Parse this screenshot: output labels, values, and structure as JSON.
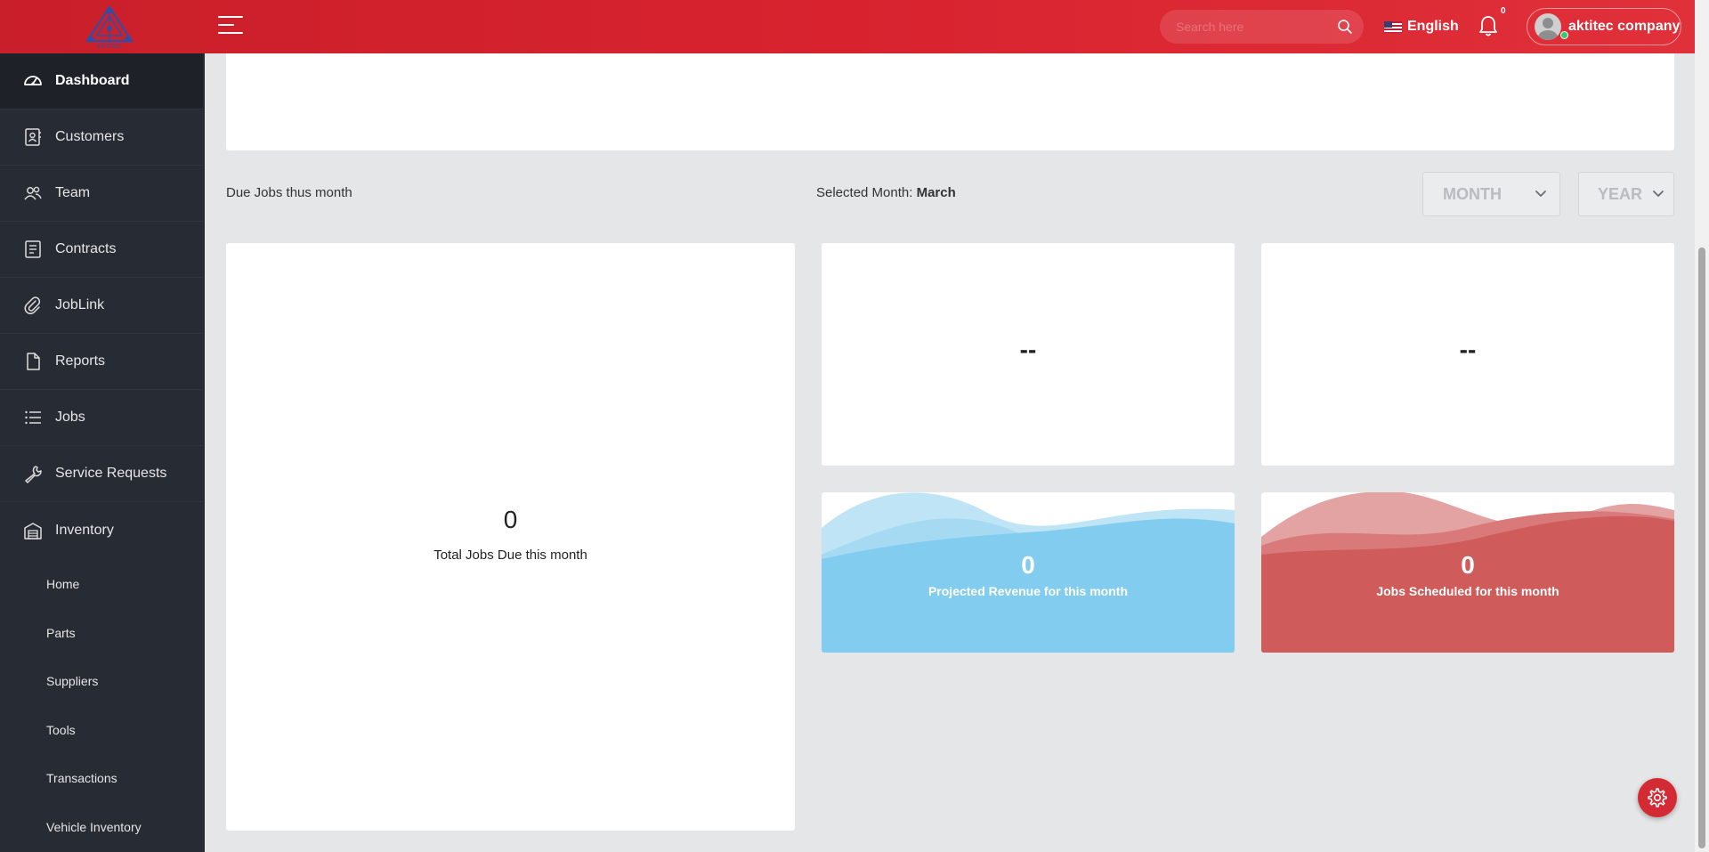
{
  "header": {
    "logo_text": "AKTITEC",
    "search_placeholder": "Search here",
    "language": "English",
    "notification_count": "0",
    "user_name": "aktitec company"
  },
  "sidebar": {
    "items": [
      {
        "label": "Dashboard",
        "icon": "speedometer-icon",
        "active": true
      },
      {
        "label": "Customers",
        "icon": "contact-book-icon"
      },
      {
        "label": "Team",
        "icon": "team-icon"
      },
      {
        "label": "Contracts",
        "icon": "contract-icon"
      },
      {
        "label": "JobLink",
        "icon": "paperclip-icon"
      },
      {
        "label": "Reports",
        "icon": "file-icon"
      },
      {
        "label": "Jobs",
        "icon": "list-icon"
      },
      {
        "label": "Service Requests",
        "icon": "wrench-icon"
      },
      {
        "label": "Inventory",
        "icon": "warehouse-icon"
      }
    ],
    "inventory_sub": [
      "Home",
      "Parts",
      "Suppliers",
      "Tools",
      "Transactions",
      "Vehicle Inventory"
    ]
  },
  "main": {
    "section_title": "Due Jobs thus month",
    "selected_month_label": "Selected Month:",
    "selected_month_value": "March",
    "month_select": "MONTH",
    "year_select": "YEAR",
    "total_jobs_value": "0",
    "total_jobs_caption": "Total Jobs Due this month",
    "stat1_value": "--",
    "stat2_value": "--",
    "revenue_value": "0",
    "revenue_caption": "Projected Revenue for this month",
    "scheduled_value": "0",
    "scheduled_caption": "Jobs Scheduled for this month"
  },
  "colors": {
    "header_red": "#d8232f",
    "sidebar": "#272b33",
    "blue_card": "#82cdef",
    "red_card": "#cf5b5b",
    "gear_button": "#d42a33"
  }
}
